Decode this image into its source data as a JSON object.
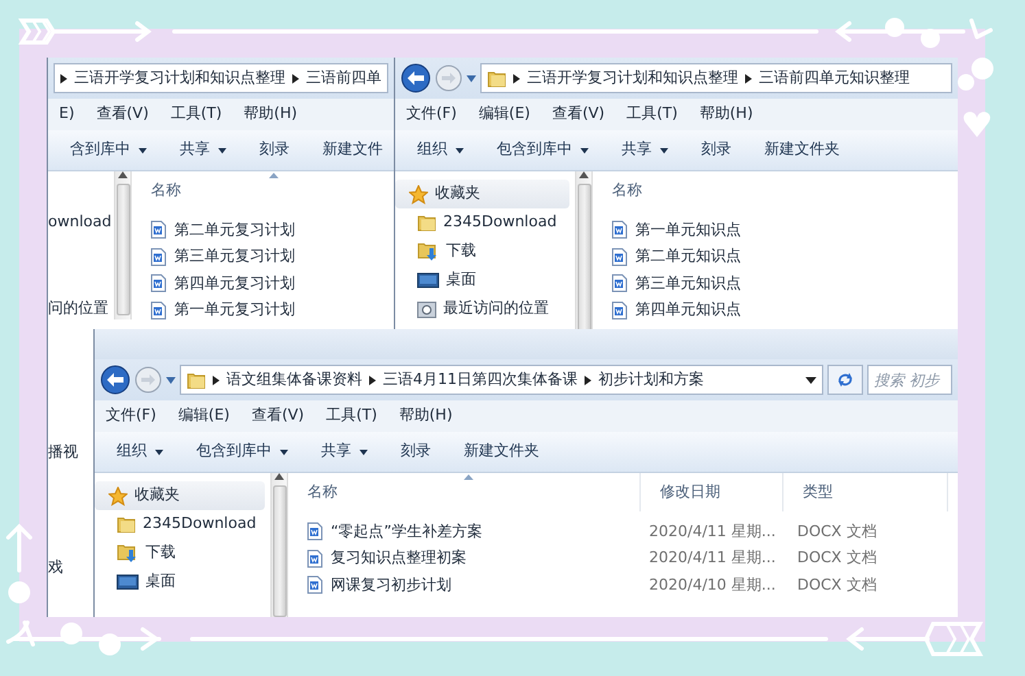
{
  "windows": [
    {
      "nav_buttons": false,
      "breadcrumb": [
        "三语开学复习计划和知识点整理",
        "三语前四单"
      ],
      "address_controls": false,
      "menu": [
        "E)",
        "查看(V)",
        "工具(T)",
        "帮助(H)"
      ],
      "toolbar": [
        {
          "label": "含到库中",
          "dropdown": true
        },
        {
          "label": "共享",
          "dropdown": true
        },
        {
          "label": "刻录",
          "dropdown": false
        },
        {
          "label": "新建文件",
          "dropdown": false
        }
      ],
      "nav": [
        {
          "label": "ownload",
          "kind": "text"
        },
        {
          "label": "问的位置",
          "kind": "text"
        },
        {
          "label": "播视",
          "kind": "text"
        },
        {
          "label": "戏",
          "kind": "text"
        }
      ],
      "columns": [
        {
          "label": "名称",
          "sorted": true
        }
      ],
      "files": [
        {
          "name": "第二单元复习计划"
        },
        {
          "name": "第三单元复习计划"
        },
        {
          "name": "第四单元复习计划"
        },
        {
          "name": "第一单元复习计划"
        }
      ]
    },
    {
      "nav_buttons": true,
      "breadcrumb": [
        "三语开学复习计划和知识点整理",
        "三语前四单元知识整理"
      ],
      "address_controls": false,
      "menu": [
        "文件(F)",
        "编辑(E)",
        "查看(V)",
        "工具(T)",
        "帮助(H)"
      ],
      "toolbar": [
        {
          "label": "组织",
          "dropdown": true
        },
        {
          "label": "包含到库中",
          "dropdown": true
        },
        {
          "label": "共享",
          "dropdown": true
        },
        {
          "label": "刻录",
          "dropdown": false
        },
        {
          "label": "新建文件夹",
          "dropdown": false
        }
      ],
      "nav": [
        {
          "label": "收藏夹",
          "kind": "favorites"
        },
        {
          "label": "2345Download",
          "kind": "folder"
        },
        {
          "label": "下载",
          "kind": "download"
        },
        {
          "label": "桌面",
          "kind": "desktop"
        },
        {
          "label": "最近访问的位置",
          "kind": "recent"
        }
      ],
      "columns": [
        {
          "label": "名称",
          "sorted": false
        }
      ],
      "files": [
        {
          "name": "第一单元知识点"
        },
        {
          "name": "第二单元知识点"
        },
        {
          "name": "第三单元知识点"
        },
        {
          "name": "第四单元知识点"
        }
      ]
    },
    {
      "nav_buttons": true,
      "breadcrumb": [
        "语文组集体备课资料",
        "三语4月11日第四次集体备课",
        "初步计划和方案"
      ],
      "address_controls": true,
      "search": {
        "placeholder": "搜索 初步"
      },
      "menu": [
        "文件(F)",
        "编辑(E)",
        "查看(V)",
        "工具(T)",
        "帮助(H)"
      ],
      "toolbar": [
        {
          "label": "组织",
          "dropdown": true
        },
        {
          "label": "包含到库中",
          "dropdown": true
        },
        {
          "label": "共享",
          "dropdown": true
        },
        {
          "label": "刻录",
          "dropdown": false
        },
        {
          "label": "新建文件夹",
          "dropdown": false
        }
      ],
      "nav": [
        {
          "label": "收藏夹",
          "kind": "favorites"
        },
        {
          "label": "2345Download",
          "kind": "folder"
        },
        {
          "label": "下载",
          "kind": "download"
        },
        {
          "label": "桌面",
          "kind": "desktop"
        }
      ],
      "columns": [
        {
          "label": "名称",
          "sorted": true
        },
        {
          "label": "修改日期",
          "sorted": false
        },
        {
          "label": "类型",
          "sorted": false
        }
      ],
      "files": [
        {
          "name": "“零起点”学生补差方案",
          "date": "2020/4/11 星期...",
          "type": "DOCX 文档"
        },
        {
          "name": "复习知识点整理初案",
          "date": "2020/4/11 星期...",
          "type": "DOCX 文档"
        },
        {
          "name": "网课复习初步计划",
          "date": "2020/4/10 星期...",
          "type": "DOCX 文档"
        }
      ]
    }
  ]
}
